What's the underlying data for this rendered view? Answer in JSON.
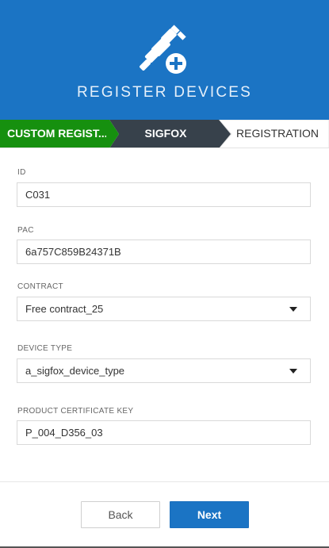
{
  "header": {
    "title": "REGISTER DEVICES",
    "icon": "plug-plus-icon",
    "background_color": "#1b74c4"
  },
  "steps": [
    {
      "label": "CUSTOM REGIST...",
      "state": "completed",
      "color": "#16900f"
    },
    {
      "label": "SIGFOX",
      "state": "active",
      "color": "#37414b"
    },
    {
      "label": "REGISTRATION",
      "state": "pending",
      "color": "#ffffff"
    }
  ],
  "form": {
    "id": {
      "label": "ID",
      "value": "C031"
    },
    "pac": {
      "label": "PAC",
      "value": "6a757C859B24371B"
    },
    "contract": {
      "label": "CONTRACT",
      "selected": "Free contract_25"
    },
    "device_type": {
      "label": "DEVICE TYPE",
      "selected": "a_sigfox_device_type"
    },
    "product_certificate_key": {
      "label": "PRODUCT CERTIFICATE KEY",
      "value": "P_004_D356_03"
    }
  },
  "footer": {
    "back_label": "Back",
    "next_label": "Next"
  }
}
